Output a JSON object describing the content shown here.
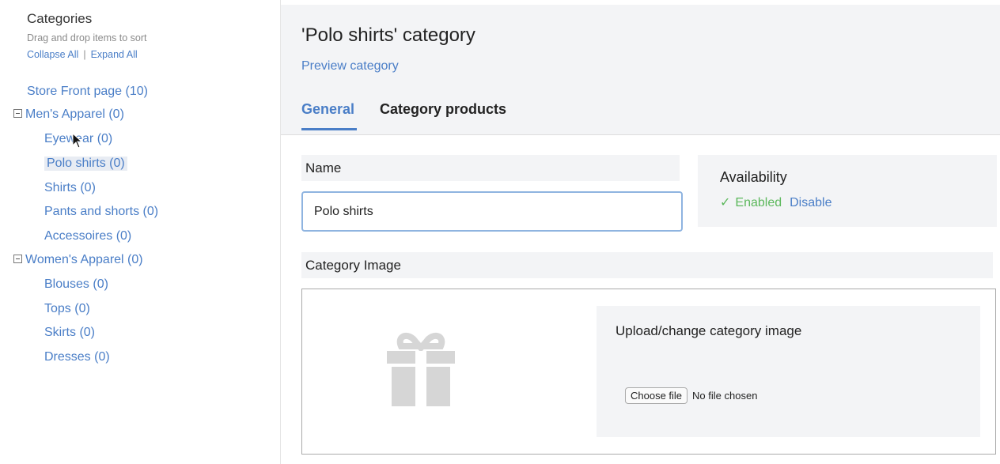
{
  "sidebar": {
    "title": "Categories",
    "hint": "Drag and drop items to sort",
    "collapse_all": "Collapse All",
    "separator": "|",
    "expand_all": "Expand All",
    "tree": [
      {
        "label": "Store Front page (10)",
        "level": "root"
      },
      {
        "label": "Men's Apparel (0)",
        "level": "group"
      },
      {
        "label": "Eyewear (0)",
        "level": "child"
      },
      {
        "label": "Polo shirts (0)",
        "level": "child",
        "selected": true
      },
      {
        "label": "Shirts (0)",
        "level": "child"
      },
      {
        "label": "Pants and shorts (0)",
        "level": "child"
      },
      {
        "label": "Accessoires (0)",
        "level": "child"
      },
      {
        "label": "Women's Apparel (0)",
        "level": "group"
      },
      {
        "label": "Blouses (0)",
        "level": "child"
      },
      {
        "label": "Tops (0)",
        "level": "child"
      },
      {
        "label": "Skirts (0)",
        "level": "child"
      },
      {
        "label": "Dresses (0)",
        "level": "child"
      }
    ]
  },
  "header": {
    "title": "'Polo shirts' category",
    "preview_link": "Preview category",
    "tabs": [
      {
        "label": "General",
        "active": true
      },
      {
        "label": "Category products",
        "active": false
      }
    ]
  },
  "form": {
    "name_label": "Name",
    "name_value": "Polo shirts",
    "availability_title": "Availability",
    "availability_status": "Enabled",
    "availability_action": "Disable",
    "image_label": "Category Image",
    "upload_title": "Upload/change category image",
    "choose_file": "Choose file",
    "no_file": "No file chosen"
  },
  "colors": {
    "accent": "#4a7ec7",
    "enabled": "#5cb85c",
    "panel_bg": "#f3f4f6"
  },
  "icons": {
    "check": "check-icon",
    "gift": "gift-icon",
    "collapse": "collapse-toggle-icon",
    "cursor": "mouse-cursor-icon"
  }
}
